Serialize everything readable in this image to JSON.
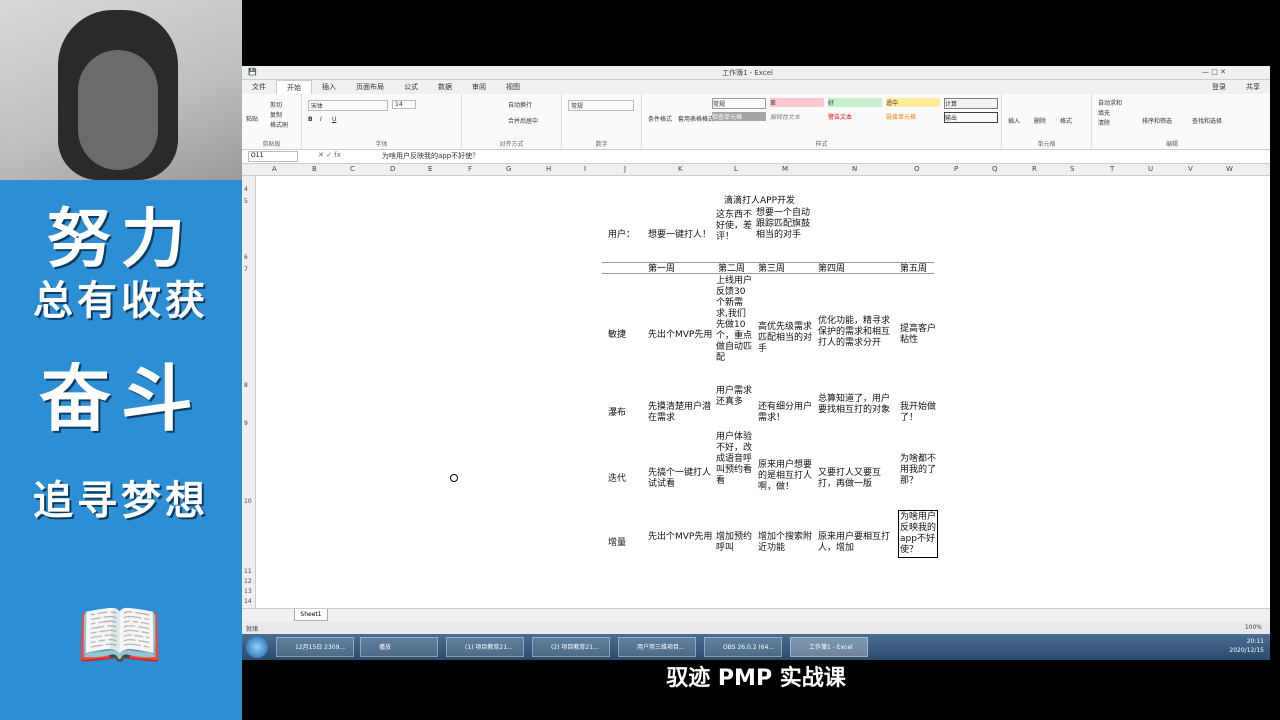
{
  "left_panel": {
    "slogan_1": "努力",
    "slogan_2": "总有收获",
    "slogan_3": "奋斗",
    "slogan_4": "追寻梦想",
    "decoration_icon": "book-icon"
  },
  "window": {
    "title": "工作簿1 - Excel",
    "user": "登录",
    "share": "共享"
  },
  "ribbon_tabs": [
    "文件",
    "开始",
    "插入",
    "页面布局",
    "公式",
    "数据",
    "审阅",
    "视图"
  ],
  "ribbon": {
    "clipboard": {
      "paste": "粘贴",
      "cut": "剪切",
      "copy": "复制",
      "format_painter": "格式刷",
      "label": "剪贴板"
    },
    "font": {
      "name": "宋体",
      "size": "14",
      "label": "字体"
    },
    "alignment": {
      "wrap": "自动换行",
      "merge": "合并后居中",
      "label": "对齐方式"
    },
    "number": {
      "format": "常规",
      "label": "数字"
    },
    "styles": {
      "conditional": "条件格式",
      "table": "套用表格格式",
      "normal": "常规",
      "bad": "差",
      "good": "好",
      "neutral": "适中",
      "calc": "计算",
      "check": "检查单元格",
      "explain": "解释性文本",
      "warn": "警告文本",
      "link": "链接单元格",
      "output": "输出",
      "label": "样式"
    },
    "cells": {
      "insert": "插入",
      "delete": "删除",
      "format": "格式",
      "label": "单元格"
    },
    "editing": {
      "autosum": "自动求和",
      "fill": "填充",
      "clear": "清除",
      "sort": "排序和筛选",
      "find": "查找和选择",
      "label": "编辑"
    }
  },
  "formula_bar": {
    "name_box": "O11",
    "formula": "为啥用户反映我的app不好使？"
  },
  "columns": [
    "A",
    "B",
    "C",
    "D",
    "E",
    "F",
    "G",
    "H",
    "I",
    "J",
    "K",
    "L",
    "M",
    "N",
    "O",
    "P",
    "Q",
    "R",
    "S",
    "T",
    "U",
    "V",
    "W"
  ],
  "rows": [
    "4",
    "5",
    "6",
    "7",
    "8",
    "9",
    "10",
    "11",
    "12",
    "13",
    "14"
  ],
  "sheet": {
    "title": "滴滴打人APP开发",
    "user_label": "用户：",
    "user_want_1": "想要一键打人！",
    "user_want_2": "这东西不好使，差评！",
    "user_want_3": "想要一个自动跟踪匹配旗鼓相当的对手",
    "weeks": [
      "第一周",
      "第二周",
      "第三周",
      "第四周",
      "第五周"
    ],
    "rows": [
      {
        "label": "敏捷",
        "cells": [
          "先出个MVP先用",
          "上线用户反馈30个新需求,我们先做10个，重点做自动匹配",
          "高优先级需求匹配相当的对手",
          "优化功能，精寻求保护的需求和相互打人的需求分开",
          "提高客户粘性"
        ]
      },
      {
        "label": "瀑布",
        "cells": [
          "先摸清楚用户潜在需求",
          "用户需求还真多",
          "还有细分用户需求！",
          "总算知道了，用户要找相互打的对象",
          "我开始做了！"
        ]
      },
      {
        "label": "迭代",
        "cells": [
          "先搞个一键打人试试看",
          "用户体验不好，改成语音呼叫预约看看",
          "原来用户想要的是相互打人啊，做！",
          "又要打人又要互打，再做一版",
          "为啥都不用我的了那？"
        ]
      },
      {
        "label": "增量",
        "cells": [
          "先出个MVP先用",
          "增加预约呼叫",
          "增加个搜索附近功能",
          "原来用户要相互打人，增加",
          "为啥用户反映我的app不好使？"
        ]
      }
    ]
  },
  "sheet_tab": "Sheet1",
  "status": {
    "ready": "就绪",
    "zoom": "100%"
  },
  "taskbar": {
    "items": [
      "12月15日 2309...",
      "播放",
      "(1) 项目教育21...",
      "(2) 项目教育21...",
      "用户努三维项目...",
      "OBS 26.0.2 (64...",
      "工作簿1 - Excel"
    ],
    "time": "20:11",
    "date": "2020/12/15"
  },
  "caption": "驭迹 PMP 实战课"
}
